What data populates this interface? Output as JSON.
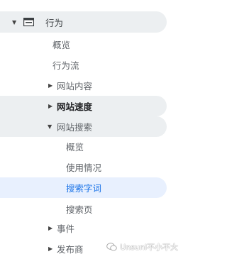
{
  "nav": {
    "header_label": "行为",
    "items": [
      {
        "label": "概览"
      },
      {
        "label": "行为流"
      },
      {
        "label": "网站内容"
      },
      {
        "label": "网站速度"
      },
      {
        "label": "网站搜索"
      },
      {
        "label": "概览"
      },
      {
        "label": "使用情况"
      },
      {
        "label": "搜索字词"
      },
      {
        "label": "搜索页"
      },
      {
        "label": "事件"
      },
      {
        "label": "发布商"
      }
    ]
  },
  "watermark": {
    "text": "Unsunl不小不大"
  },
  "colors": {
    "accent": "#1a73e8",
    "selected_bg": "#e8f0fe",
    "hover_bg": "#eceff1"
  }
}
